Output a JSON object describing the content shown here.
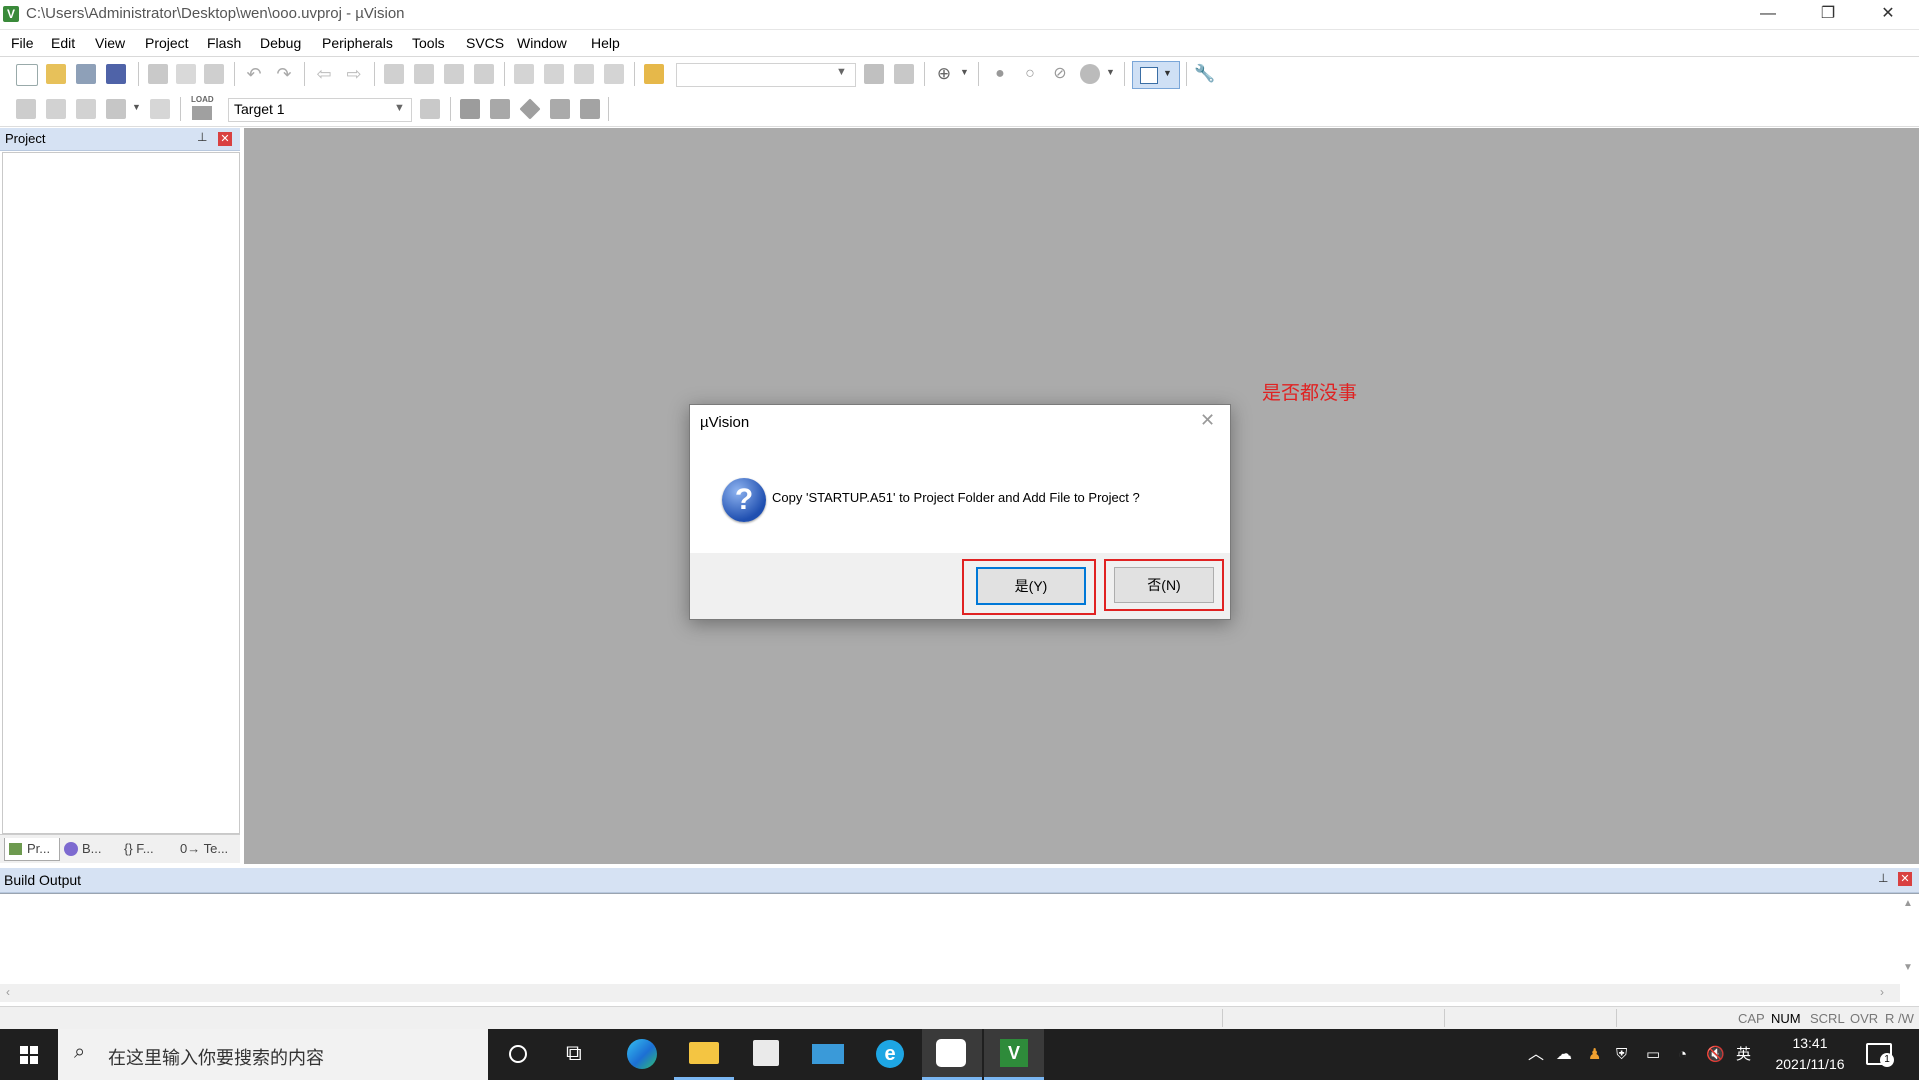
{
  "window": {
    "title": "C:\\Users\\Administrator\\Desktop\\wen\\ooo.uvproj - µVision",
    "controls": [
      "—",
      "❐",
      "✕"
    ]
  },
  "menu": [
    "File",
    "Edit",
    "View",
    "Project",
    "Flash",
    "Debug",
    "Peripherals",
    "Tools",
    "SVCS",
    "Window",
    "Help"
  ],
  "toolbar": {
    "target": "Target 1",
    "load_label": "LOAD"
  },
  "project_panel": {
    "title": "Project",
    "tabs": [
      "Pr...",
      "B...",
      "{} F...",
      "0→ Te..."
    ]
  },
  "annotation": {
    "text": "是否都没事",
    "color": "#e02222"
  },
  "dialog": {
    "title": "µVision",
    "message": "Copy 'STARTUP.A51' to Project Folder and Add File to Project ?",
    "yes_label": "是(Y)",
    "no_label": "否(N)"
  },
  "build_output": {
    "title": "Build Output"
  },
  "statusbar": {
    "indicators": [
      "CAP",
      "NUM",
      "SCRL",
      "OVR",
      "R /W"
    ],
    "active": "NUM"
  },
  "taskbar": {
    "search_placeholder": "在这里输入你要搜索的内容",
    "time": "13:41",
    "date": "2021/11/16",
    "ime": "英",
    "notification_count": "1"
  },
  "colors": {
    "panel_header": "#d6e2f3",
    "editor_bg": "#ababab",
    "highlight": "#e02222",
    "taskbar": "#1f1f1f"
  }
}
